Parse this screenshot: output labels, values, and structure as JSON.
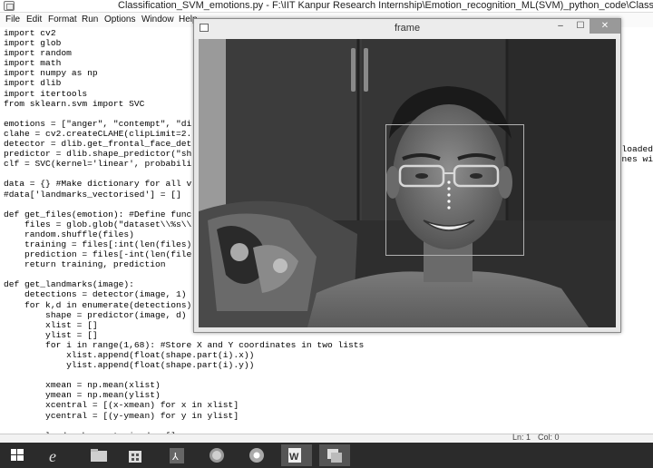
{
  "window": {
    "title": "Classification_SVM_emotions.py - F:\\IIT Kanpur Research Internship\\Emotion_recognition_ML(SVM)_python_code\\Classificatio"
  },
  "menu": [
    "File",
    "Edit",
    "Format",
    "Run",
    "Options",
    "Window",
    "Help"
  ],
  "code_lines": [
    "import cv2",
    "import glob",
    "import random",
    "import math",
    "import numpy as np",
    "import dlib",
    "import itertools",
    "from sklearn.svm import SVC",
    "",
    "emotions = [\"anger\", \"contempt\", \"di",
    "clahe = cv2.createCLAHE(clipLimit=2.",
    "detector = dlib.get_frontal_face_det",
    "predictor = dlib.shape_predictor(\"sh",
    "clf = SVC(kernel='linear', probabili",
    "",
    "data = {} #Make dictionary for all v",
    "#data['landmarks_vectorised'] = []",
    "",
    "def get_files(emotion): #Define func",
    "    files = glob.glob(\"dataset\\\\%s\\\\",
    "    random.shuffle(files)",
    "    training = files[:int(len(files)",
    "    prediction = files[-int(len(file",
    "    return training, prediction",
    "",
    "def get_landmarks(image):",
    "    detections = detector(image, 1)",
    "    for k,d in enumerate(detections)",
    "        shape = predictor(image, d)",
    "        xlist = []",
    "        ylist = []",
    "        for i in range(1,68): #Store X and Y coordinates in two lists",
    "            xlist.append(float(shape.part(i).x))",
    "            ylist.append(float(shape.part(i).y))",
    "",
    "        xmean = np.mean(xlist)",
    "        ymean = np.mean(ylist)",
    "        xcentral = [(x-xmean) for x in xlist]",
    "        ycentral = [(y-ymean) for y in ylist]",
    "",
    "        landmarks_vectorised = []",
    "        for x, y, w, z in zip(xcentral, ycentral, xlist, ylist):"
  ],
  "right_fragments": [
    "loaded",
    "nes wi"
  ],
  "frame_window": {
    "title": "frame",
    "minimize": "–",
    "maximize": "☐",
    "close": "✕"
  },
  "status": {
    "line": "Ln: 1",
    "col": "Col: 0"
  },
  "taskbar": {
    "items": [
      "windows-start",
      "internet-explorer",
      "file-explorer",
      "store",
      "acrobat",
      "firefox",
      "chrome",
      "word",
      "python-idle"
    ]
  }
}
